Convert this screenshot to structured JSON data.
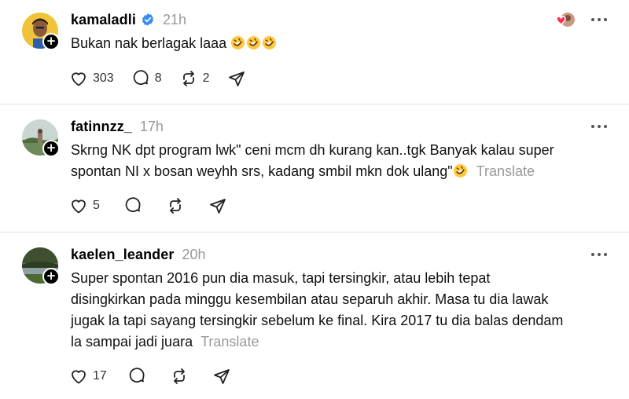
{
  "posts": [
    {
      "username": "kamaladli",
      "verified": true,
      "time": "21h",
      "text": "Bukan nak berlagak laaa",
      "emoji": [
        "rofl-emoji",
        "rofl-emoji",
        "rofl-emoji"
      ],
      "translate": "",
      "likes": "303",
      "replies": "8",
      "reposts": "2",
      "avatar_colors": [
        "#f2c230",
        "#3a2a22"
      ]
    },
    {
      "username": "fatinnzz_",
      "verified": false,
      "time": "17h",
      "lines": [
        "Skrng NK dpt program lwk\" ceni mcm dh kurang kan..tgk Banyak kalau super",
        "spontan NI x bosan weyhh srs, kadang smbil mkn dok ulang\""
      ],
      "translate": "Translate",
      "likes": "5",
      "replies": "",
      "reposts": ""
    },
    {
      "username": "kaelen_leander",
      "verified": false,
      "time": "20h",
      "lines": [
        "Super spontan 2016 pun dia masuk, tapi tersingkir, atau lebih tepat",
        "disingkirkan pada minggu kesembilan atau separuh akhir. Masa tu dia lawak",
        "jugak la tapi sayang tersingkir sebelum ke final. Kira 2017 tu dia balas dendam",
        "la sampai jadi juara"
      ],
      "translate": "Translate",
      "likes": "17",
      "replies": "",
      "reposts": ""
    }
  ]
}
